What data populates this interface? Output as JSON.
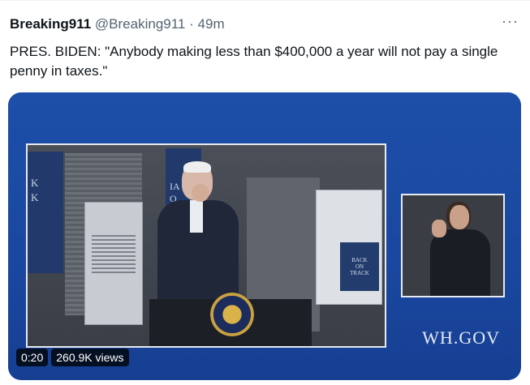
{
  "tweet": {
    "display_name": "Breaking911",
    "handle": "@Breaking911",
    "separator": "·",
    "time": "49m",
    "more_label": "···",
    "text": "PRES. BIDEN: \"Anybody making less than $400,000 a year will not pay a single penny in taxes.\""
  },
  "video": {
    "duration": "0:20",
    "views": "260.9K views",
    "watermark": "WH.GOV",
    "banner_left_text": "K\nK",
    "banner_mid_text": "IA\nO\nN",
    "sign_text": "BACK\nON\nTRACK"
  },
  "colors": {
    "media_background": "#1a47a0",
    "text": "#0f1419",
    "muted": "#536471"
  }
}
